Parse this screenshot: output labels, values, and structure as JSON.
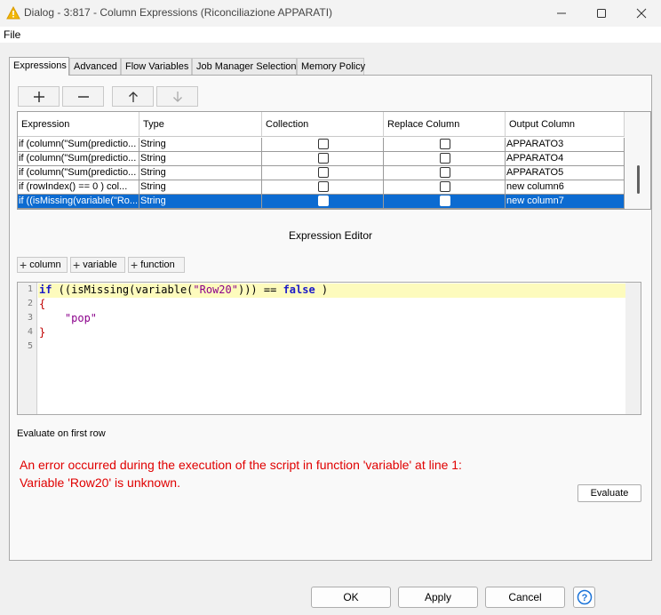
{
  "window": {
    "title": "Dialog - 3:817 - Column Expressions (Riconciliazione APPARATI)",
    "minimize_icon": "minimize-icon",
    "maximize_icon": "maximize-icon",
    "close_icon": "close-icon"
  },
  "menu": {
    "file": "File"
  },
  "tabs": [
    "Expressions",
    "Advanced",
    "Flow Variables",
    "Job Manager Selection",
    "Memory Policy"
  ],
  "toolbar": {
    "add_icon": "plus-icon",
    "remove_icon": "minus-icon",
    "up_icon": "arrow-up-icon",
    "down_icon": "arrow-down-icon"
  },
  "table": {
    "columns": [
      "Expression",
      "Type",
      "Collection",
      "Replace Column",
      "Output Column"
    ],
    "rows": [
      {
        "expression": "if (column(\"Sum(predictio...",
        "type": "String",
        "collection": false,
        "replace": false,
        "output": "APPARATO3"
      },
      {
        "expression": "if (column(\"Sum(predictio...",
        "type": "String",
        "collection": false,
        "replace": false,
        "output": "APPARATO4"
      },
      {
        "expression": "if (column(\"Sum(predictio...",
        "type": "String",
        "collection": false,
        "replace": false,
        "output": "APPARATO5"
      },
      {
        "expression": "if (rowIndex() == 0 ) col...",
        "type": "String",
        "collection": false,
        "replace": false,
        "output": "new column6"
      },
      {
        "expression": "if ((isMissing(variable(\"Ro...",
        "type": "String",
        "collection": false,
        "replace": false,
        "output": "new column7",
        "selected": true
      }
    ]
  },
  "editor": {
    "title": "Expression Editor",
    "insert_buttons": [
      "column",
      "variable",
      "function"
    ],
    "line_numbers": [
      "1",
      "2",
      "3",
      "4",
      "5"
    ],
    "code": {
      "l1_kw1": "if",
      "l1_a": " ((isMissing(variable(",
      "l1_str": "\"Row20\"",
      "l1_b": "))) == ",
      "l1_kw2": "false",
      "l1_c": " )",
      "l2": "{",
      "l3_indent": "    ",
      "l3_str": "\"pop\"",
      "l4": "}"
    }
  },
  "evaluate_label": "Evaluate on first row",
  "error": {
    "line1": "An error occurred during the execution of the script in function 'variable' at line 1:",
    "line2": "Variable 'Row20' is unknown."
  },
  "buttons": {
    "evaluate": "Evaluate",
    "ok": "OK",
    "apply": "Apply",
    "cancel": "Cancel",
    "help_icon": "help-icon"
  },
  "colors": {
    "selection": "#0c6bd1",
    "error": "#e00000",
    "current_line": "#fdfbbd",
    "keyword": "#1a1ac8",
    "string": "#8b008b",
    "warning_icon": "#f2b705"
  }
}
